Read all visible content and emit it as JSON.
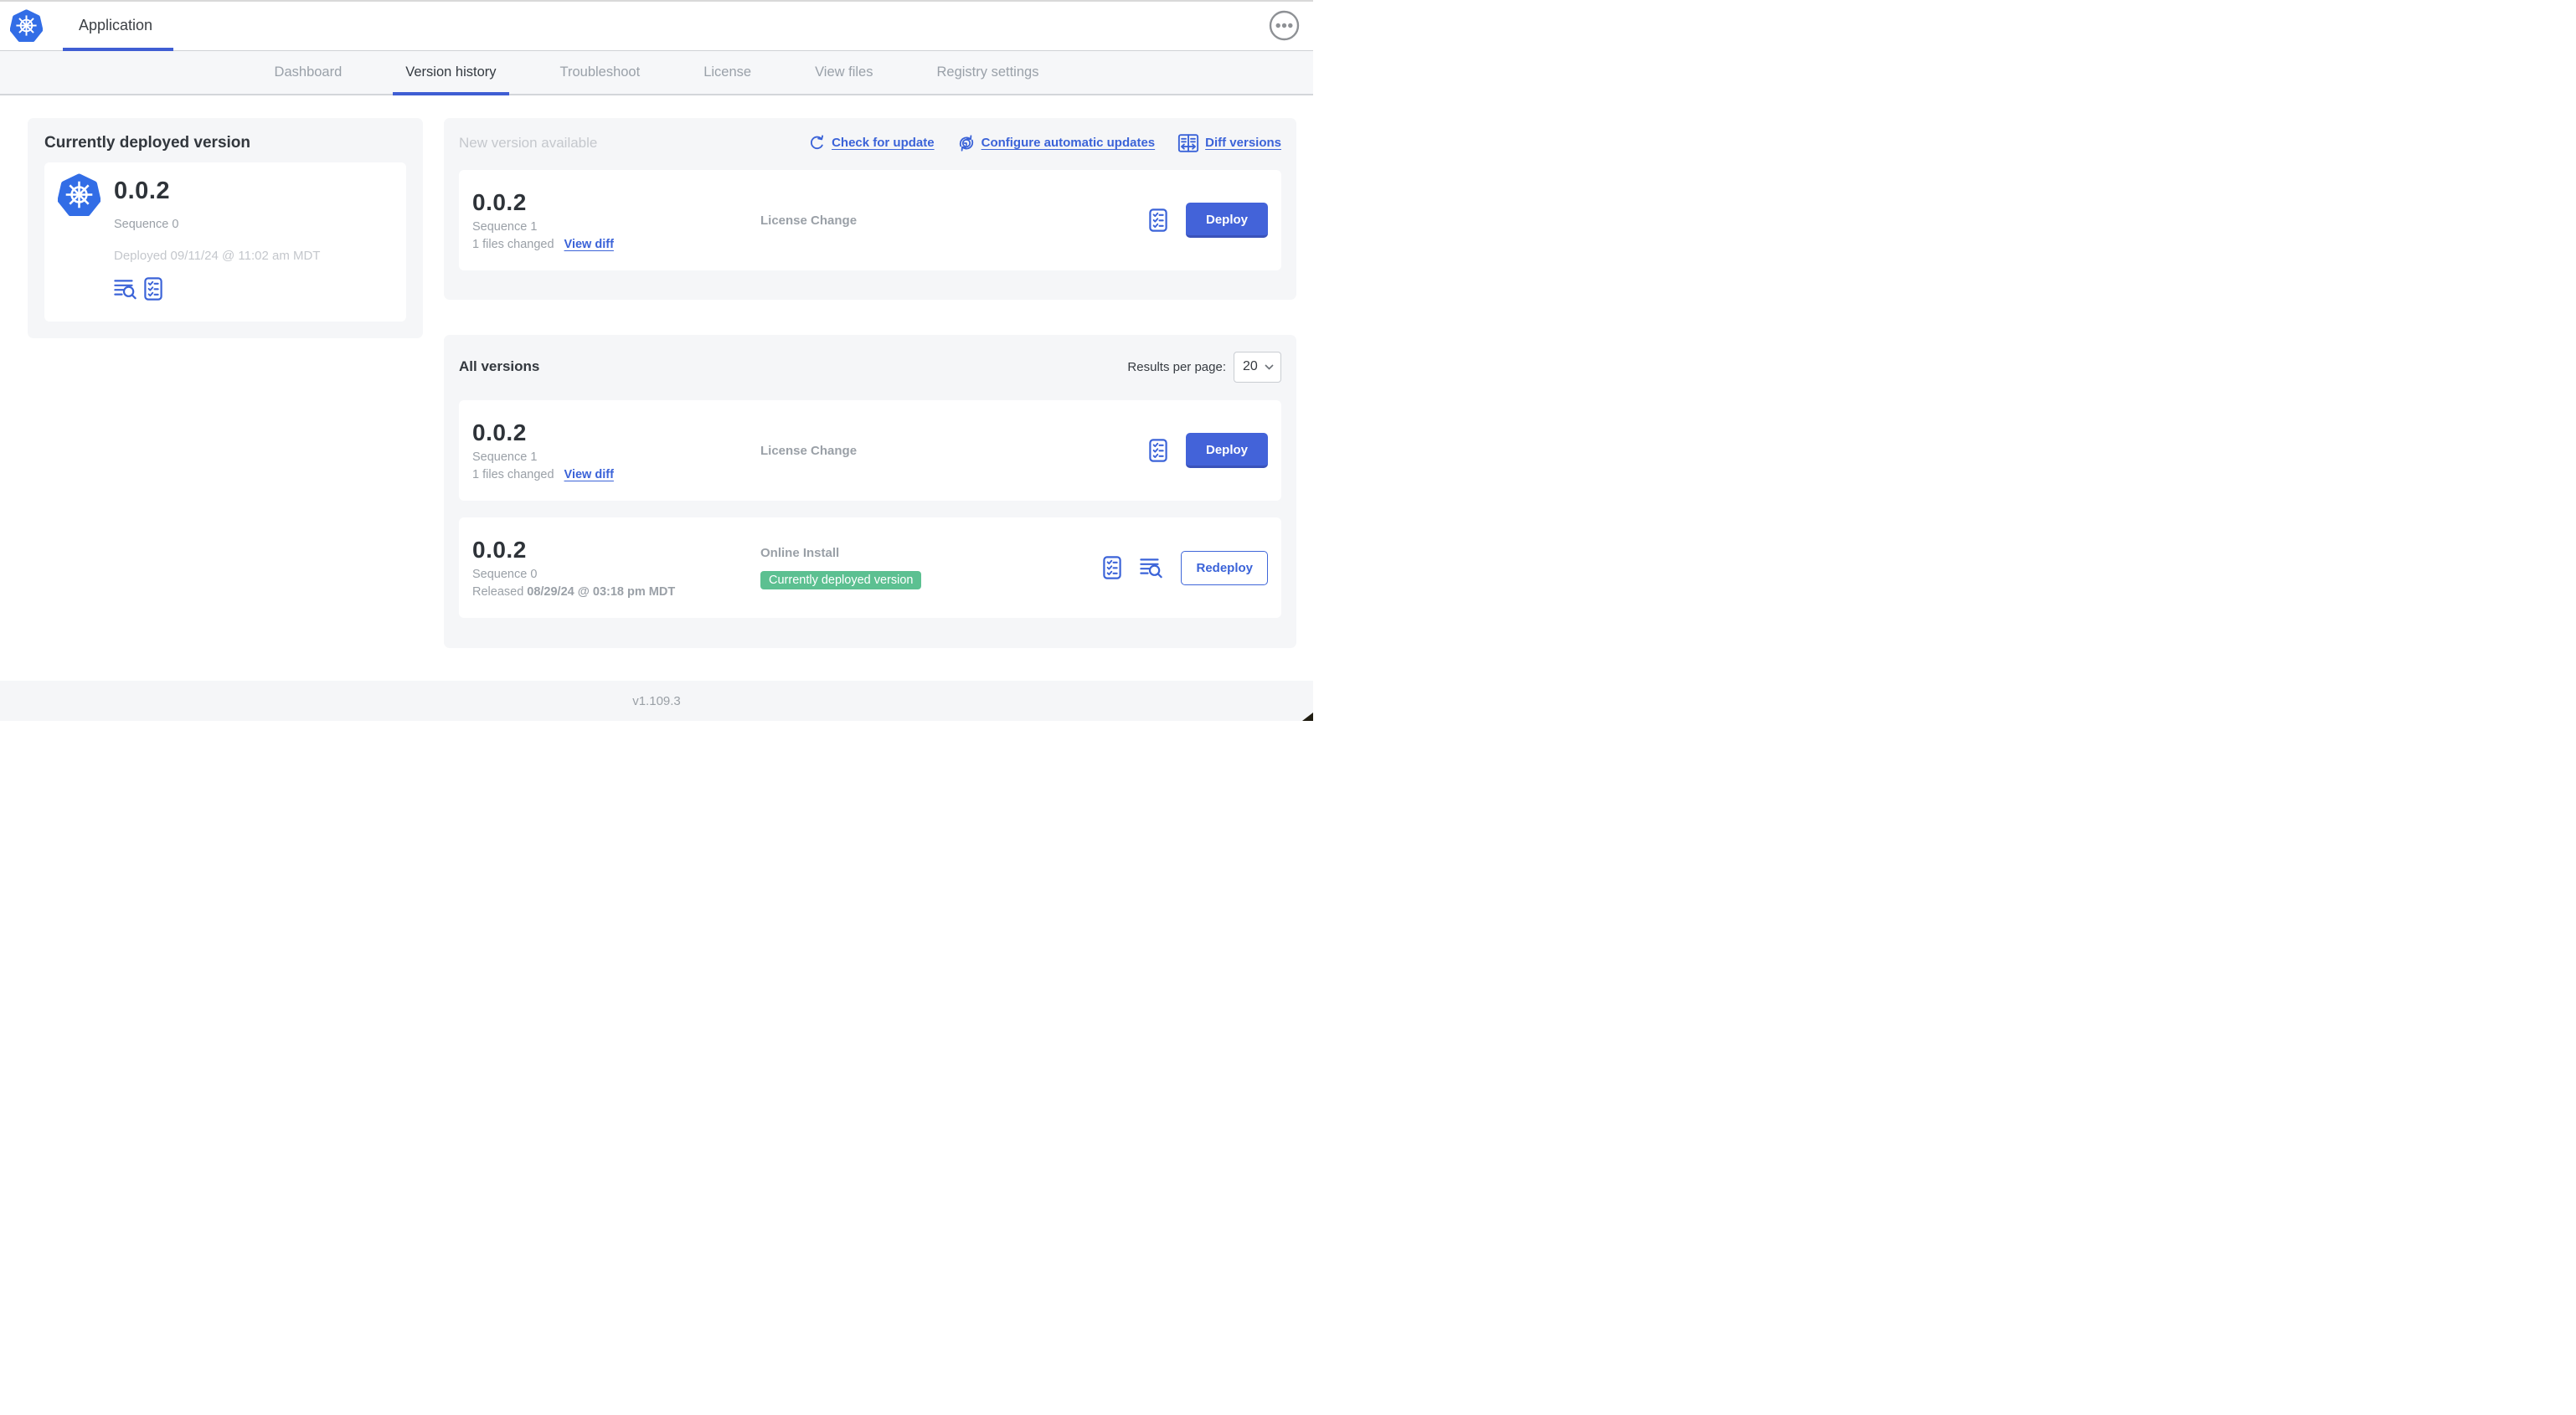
{
  "header": {
    "title": "Application"
  },
  "tabs": [
    {
      "label": "Dashboard",
      "active": false
    },
    {
      "label": "Version history",
      "active": true
    },
    {
      "label": "Troubleshoot",
      "active": false
    },
    {
      "label": "License",
      "active": false
    },
    {
      "label": "View files",
      "active": false
    },
    {
      "label": "Registry settings",
      "active": false
    }
  ],
  "current_version_card": {
    "title": "Currently deployed version",
    "version": "0.0.2",
    "sequence": "Sequence 0",
    "deployed": "Deployed 09/11/24 @ 11:02 am MDT"
  },
  "new_version_section": {
    "title": "New version available",
    "links": [
      {
        "label": "Check for update",
        "icon": "refresh-icon"
      },
      {
        "label": "Configure automatic updates",
        "icon": "auto-update-icon"
      },
      {
        "label": "Diff versions",
        "icon": "diff-icon"
      }
    ],
    "row": {
      "version": "0.0.2",
      "sequence": "Sequence 1",
      "files_changed": "1 files changed",
      "view_diff": "View diff",
      "source": "License Change",
      "action": "Deploy"
    }
  },
  "all_versions_section": {
    "title": "All versions",
    "results_per_page_label": "Results per page:",
    "results_per_page_value": "20",
    "rows": [
      {
        "version": "0.0.2",
        "sequence": "Sequence 1",
        "files_changed": "1 files changed",
        "view_diff": "View diff",
        "source": "License Change",
        "action": "Deploy"
      },
      {
        "version": "0.0.2",
        "sequence": "Sequence 0",
        "released_prefix": "Released",
        "released_date": "08/29/24 @ 03:18 pm MDT",
        "source": "Online Install",
        "badge": "Currently deployed version",
        "action": "Redeploy"
      }
    ]
  },
  "footer": {
    "version": "v1.109.3"
  },
  "colors": {
    "accent_blue": "#3b63d8",
    "button_blue": "#4363d9",
    "button_blue_dark": "#3a52ba",
    "kubernetes_blue": "#326de6",
    "badge_green": "#5cc091",
    "card_gray": "#f5f6f8"
  }
}
